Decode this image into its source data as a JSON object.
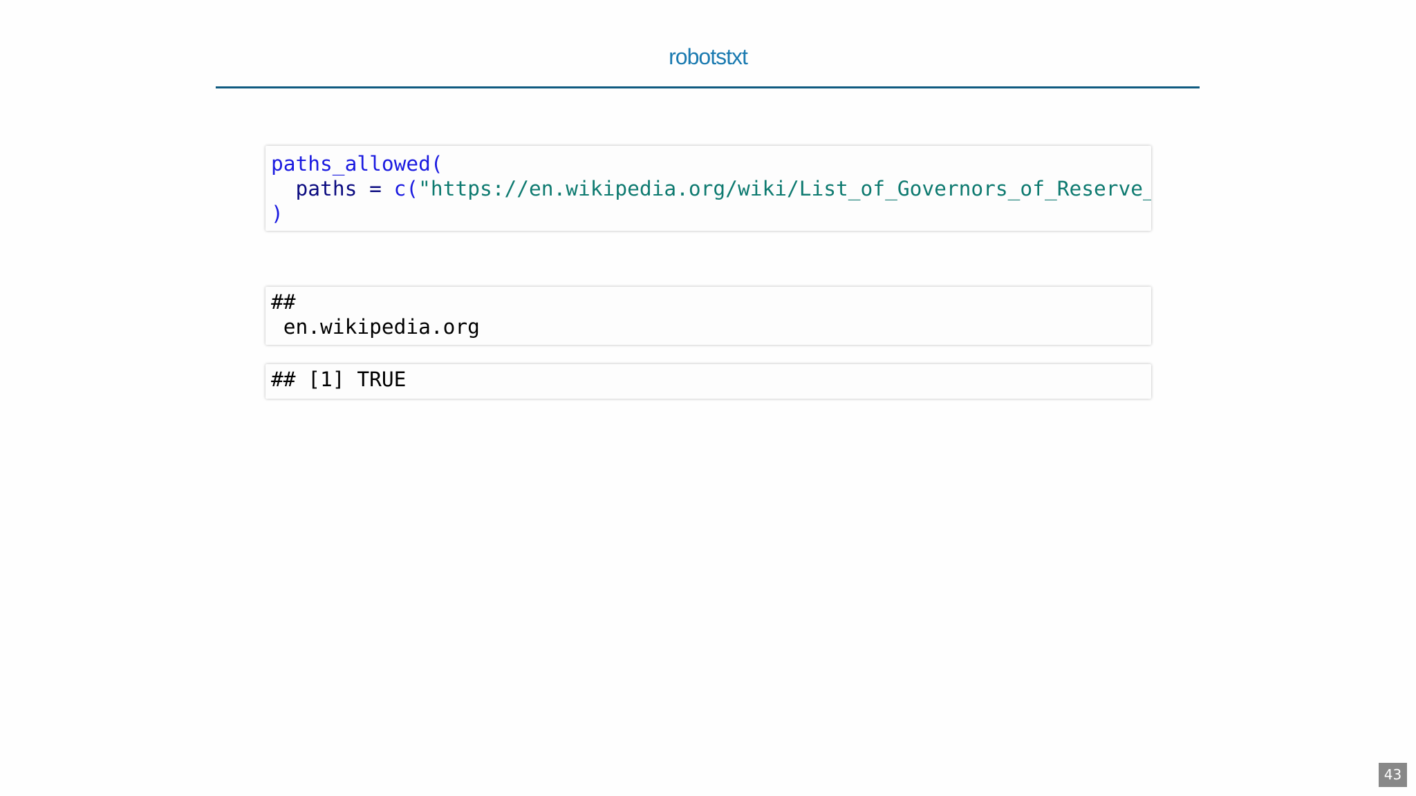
{
  "slide": {
    "title": "robotstxt",
    "page_number": "43"
  },
  "code": {
    "line1_fn": "paths_allowed(",
    "line2_indent": "  ",
    "line2_arg": "paths",
    "line2_op": " = ",
    "line2_fn": "c(",
    "line2_str": "\"https://en.wikipedia.org/wiki/List_of_Governors_of_Reserve_",
    "line3_close": ")"
  },
  "output": {
    "block1_line1": "##",
    "block1_line2": " en.wikipedia.org",
    "block2_line1": "## [1] TRUE"
  },
  "colors": {
    "title": "#1a7ab0",
    "rule": "#0f5a80",
    "function": "#1a1ae0",
    "argument": "#0b0b80",
    "string": "#0e7a70",
    "page_badge": "#888888"
  }
}
